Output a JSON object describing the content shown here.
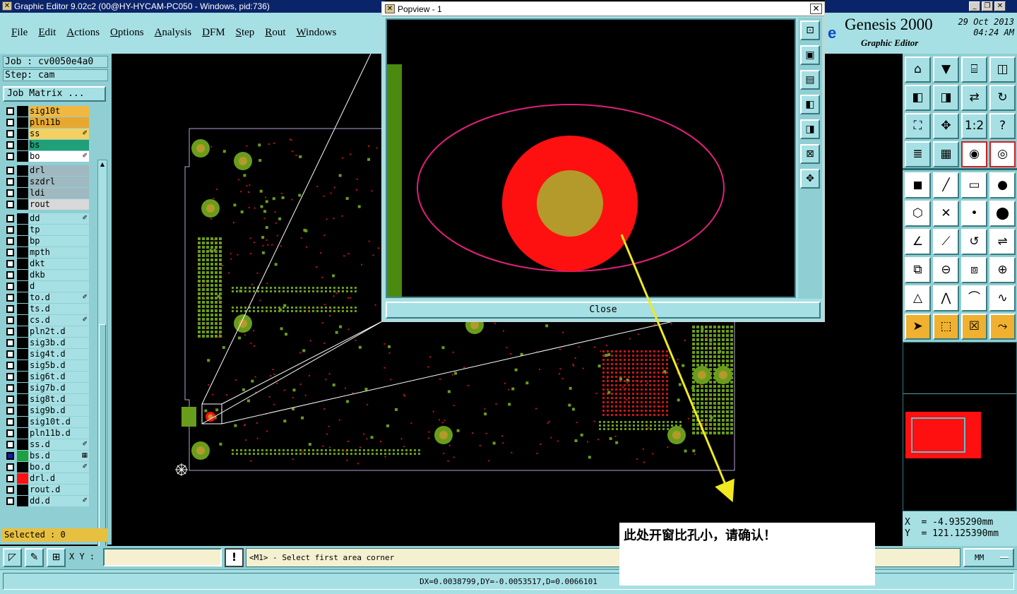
{
  "window": {
    "title": "Graphic Editor 9.02c2 (00@HY-HYCAM-PC050 - Windows, pid:736)",
    "controls": [
      "_",
      "❐",
      "✕"
    ]
  },
  "menu": [
    "File",
    "Edit",
    "Actions",
    "Options",
    "Analysis",
    "DFM",
    "Step",
    "Rout",
    "Windows"
  ],
  "brand": {
    "logo_fragment": "e",
    "name": "Genesis 2000",
    "subtitle": "Graphic Editor",
    "date": "29 Oct 2013",
    "time": "04:24 AM"
  },
  "job": {
    "job_line": "Job : cv0050e4a0",
    "step_line": "Step: cam",
    "matrix_button": "Job Matrix ...",
    "selected": "Selected : 0"
  },
  "layers": [
    {
      "name": "sig10t",
      "color": "#f0b840",
      "mark": "#000000",
      "tick": ""
    },
    {
      "name": "pln11b",
      "color": "#e8a830",
      "mark": "#000000",
      "tick": ""
    },
    {
      "name": "ss",
      "color": "#f4d060",
      "mark": "#000000",
      "tick": "✐"
    },
    {
      "name": "bs",
      "color": "#20a078",
      "mark": "#000000",
      "tick": ""
    },
    {
      "name": "bo",
      "color": "#ffffff",
      "mark": "#000000",
      "tick": "✐"
    },
    {
      "name": "drl",
      "color": "#a0b8c0",
      "mark": "#000000",
      "tick": ""
    },
    {
      "name": "szdrl",
      "color": "#a0b8c0",
      "mark": "#000000",
      "tick": ""
    },
    {
      "name": "ldi",
      "color": "#a0b8c0",
      "mark": "#000000",
      "tick": ""
    },
    {
      "name": "rout",
      "color": "#d8d8d8",
      "mark": "#000000",
      "tick": ""
    },
    {
      "name": "dd",
      "color": "#a6e0e4",
      "mark": "#000000",
      "tick": "✐"
    },
    {
      "name": "tp",
      "color": "#a6e0e4",
      "mark": "#000000",
      "tick": ""
    },
    {
      "name": "bp",
      "color": "#a6e0e4",
      "mark": "#000000",
      "tick": ""
    },
    {
      "name": "mpth",
      "color": "#a6e0e4",
      "mark": "#000000",
      "tick": ""
    },
    {
      "name": "dkt",
      "color": "#a6e0e4",
      "mark": "#000000",
      "tick": ""
    },
    {
      "name": "dkb",
      "color": "#a6e0e4",
      "mark": "#000000",
      "tick": ""
    },
    {
      "name": "d",
      "color": "#a6e0e4",
      "mark": "#000000",
      "tick": ""
    },
    {
      "name": "to.d",
      "color": "#a6e0e4",
      "mark": "#000000",
      "tick": "✐"
    },
    {
      "name": "ts.d",
      "color": "#a6e0e4",
      "mark": "#000000",
      "tick": ""
    },
    {
      "name": "cs.d",
      "color": "#a6e0e4",
      "mark": "#000000",
      "tick": "✐"
    },
    {
      "name": "pln2t.d",
      "color": "#a6e0e4",
      "mark": "#000000",
      "tick": ""
    },
    {
      "name": "sig3b.d",
      "color": "#a6e0e4",
      "mark": "#000000",
      "tick": ""
    },
    {
      "name": "sig4t.d",
      "color": "#a6e0e4",
      "mark": "#000000",
      "tick": ""
    },
    {
      "name": "sig5b.d",
      "color": "#a6e0e4",
      "mark": "#000000",
      "tick": ""
    },
    {
      "name": "sig6t.d",
      "color": "#a6e0e4",
      "mark": "#000000",
      "tick": ""
    },
    {
      "name": "sig7b.d",
      "color": "#a6e0e4",
      "mark": "#000000",
      "tick": ""
    },
    {
      "name": "sig8t.d",
      "color": "#a6e0e4",
      "mark": "#000000",
      "tick": ""
    },
    {
      "name": "sig9b.d",
      "color": "#a6e0e4",
      "mark": "#000000",
      "tick": ""
    },
    {
      "name": "sig10t.d",
      "color": "#a6e0e4",
      "mark": "#000000",
      "tick": ""
    },
    {
      "name": "pln11b.d",
      "color": "#a6e0e4",
      "mark": "#000000",
      "tick": ""
    },
    {
      "name": "ss.d",
      "color": "#a6e0e4",
      "mark": "#000000",
      "tick": "✐"
    },
    {
      "name": "bs.d",
      "color": "#a6e0e4",
      "mark": "#20a040",
      "tick": "▦",
      "checked_color": "#1020a0"
    },
    {
      "name": "bo.d",
      "color": "#a6e0e4",
      "mark": "#000000",
      "tick": "✐"
    },
    {
      "name": "drl.d",
      "color": "#a6e0e4",
      "mark": "#ff1010",
      "tick": ""
    },
    {
      "name": "rout.d",
      "color": "#a6e0e4",
      "mark": "#000000",
      "tick": ""
    },
    {
      "name": "dd.d",
      "color": "#a6e0e4",
      "mark": "#000000",
      "tick": "✐"
    }
  ],
  "popview": {
    "title": "Popview - 1",
    "close_label": "Close",
    "tool_icons": [
      "zoom-window-icon",
      "zoom-in-icon",
      "zoom-out-icon",
      "pan-left-icon",
      "pan-right-icon",
      "fit-icon",
      "move-icon"
    ]
  },
  "toolbox": {
    "tools": [
      [
        "home-icon",
        "down-icon",
        "layers-icon",
        "window-icon"
      ],
      [
        "prev-icon",
        "next-icon",
        "swap-icon",
        "redraw-icon"
      ],
      [
        "fit-all-icon",
        "center-icon",
        "scale-1-2-icon",
        "help-icon"
      ],
      [
        "ruler-icon",
        "grid-icon",
        "display-icon",
        "snap-icon"
      ],
      [
        "feature-icon",
        "line-icon",
        "measure-icon",
        "pad-icon"
      ],
      [
        "net-icon",
        "cross-icon",
        "point-icon",
        "vertex-icon"
      ],
      [
        "angle-icon",
        "diagonal-icon",
        "arc-icon",
        "mirror-icon"
      ],
      [
        "copy-icon",
        "split-icon",
        "array-icon",
        "group-icon"
      ],
      [
        "triangle-icon",
        "arch-icon",
        "dome-icon",
        "wave-icon"
      ],
      [
        "select-icon",
        "select-box-icon",
        "select-mark-icon",
        "route-icon"
      ]
    ],
    "tool_labels": {
      "scale-1-2-icon": "1:2",
      "help-icon": "?"
    }
  },
  "coords": {
    "x_line": "X  = -4.935290mm",
    "y_line": "Y  = 121.125390mm"
  },
  "bottom": {
    "xy_label": "X Y :",
    "xy_value": "",
    "msg_icon": "!",
    "message": "<M1> - Select first area corner",
    "units": "MM",
    "status": "DX=0.0038799,DY=-0.0053517,D=0.0066101"
  },
  "annotation": {
    "text": "此处开窗比孔小，请确认！"
  },
  "colors": {
    "panel": "#a6e0e4",
    "panel_dark": "#8fcfd3",
    "board_outline": "#b8a0d8",
    "pad_green": "#6a9c1c",
    "pad_gold": "#b49a2a",
    "smd_red": "#c81414",
    "arrow": "#f0e820",
    "ellipse": "#e0207a",
    "pad_red": "#ff1010"
  }
}
